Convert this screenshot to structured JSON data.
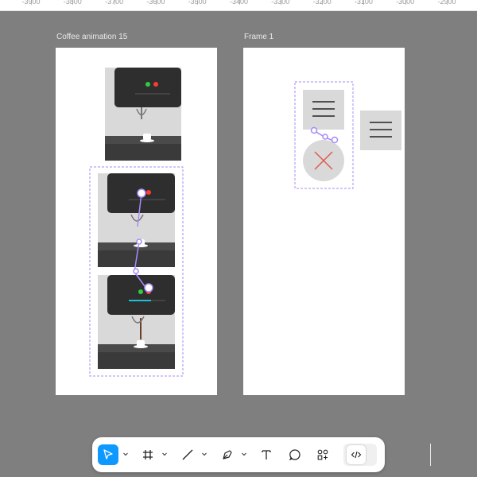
{
  "ruler": {
    "labels": [
      "-3900",
      "-3800",
      "-3700",
      "-3600",
      "-3500",
      "-3400",
      "-3300",
      "-3200",
      "-3100",
      "-3000",
      "-2900"
    ]
  },
  "frames": {
    "left_title": "Coffee animation 15",
    "right_title": "Frame 1"
  },
  "colors": {
    "canvas": "#7f7f7f",
    "selection": "#a78bfa",
    "accent": "#0d99ff",
    "machine_dark": "#2e2e2e",
    "machine_light": "#d9d9d9",
    "close_x": "#e05a4e"
  },
  "toolbar": {
    "tools": [
      {
        "name": "move-tool",
        "icon": "cursor-arrow-icon",
        "active": true
      },
      {
        "name": "frame-tool",
        "icon": "hash-frame-icon"
      },
      {
        "name": "line-tool",
        "icon": "line-icon"
      },
      {
        "name": "pen-tool",
        "icon": "pen-nib-icon"
      },
      {
        "name": "text-tool",
        "icon": "text-T-icon"
      },
      {
        "name": "comment-tool",
        "icon": "comment-bubble-icon"
      },
      {
        "name": "actions-tool",
        "icon": "shapes-plus-icon"
      },
      {
        "name": "dev-mode-toggle",
        "icon": "code-brackets-icon"
      }
    ]
  }
}
